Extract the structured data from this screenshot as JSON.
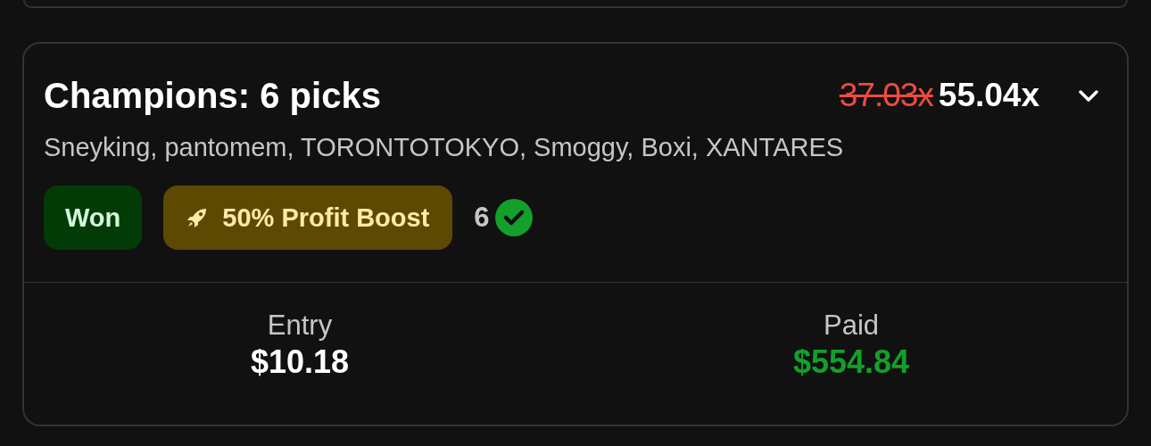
{
  "entry_card": {
    "title": "Champions: 6 picks",
    "old_multiplier": "37.03x",
    "multiplier": "55.04x",
    "expanded": false,
    "players": "Sneyking, pantomem, TORONTOTOKYO, Smoggy, Boxi, XANTARES",
    "status": "Won",
    "boost": "50% Profit Boost",
    "correct_count": "6",
    "stats": [
      {
        "label": "Entry",
        "value": "$10.18",
        "kind": "plain"
      },
      {
        "label": "Paid",
        "value": "$554.84",
        "kind": "payout"
      }
    ]
  }
}
